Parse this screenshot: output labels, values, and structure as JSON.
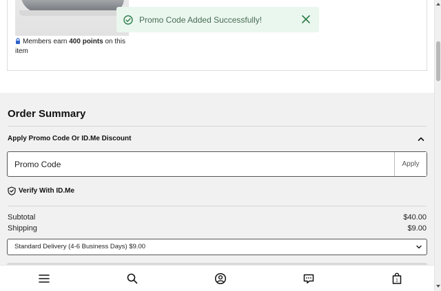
{
  "product": {
    "points_prefix": "Members earn ",
    "points_value": "400 points",
    "points_suffix": " on this item"
  },
  "toast": {
    "message": "Promo Code Added Successfully!"
  },
  "summary": {
    "title": "Order Summary",
    "promo_toggle_label": "Apply Promo Code Or ID.Me Discount",
    "promo_placeholder": "Promo Code",
    "apply_label": "Apply",
    "verify_label": "Verify With ID.Me",
    "subtotal_label": "Subtotal",
    "subtotal_value": "$40.00",
    "shipping_label": "Shipping",
    "shipping_value": "$9.00",
    "delivery_option": "Standard Delivery (4-6 Business Days) $9.00"
  },
  "nav": {
    "cart_count": "1"
  },
  "colors": {
    "toast_bg": "#eaf7ee",
    "toast_accent": "#2e7d4a",
    "summary_bg": "#f1f1f1"
  },
  "icons": [
    "lock-icon",
    "check-circle-icon",
    "close-icon",
    "chevron-up-icon",
    "shield-check-icon",
    "chevron-down-icon",
    "menu-icon",
    "search-icon",
    "account-icon",
    "chat-icon",
    "cart-icon"
  ]
}
